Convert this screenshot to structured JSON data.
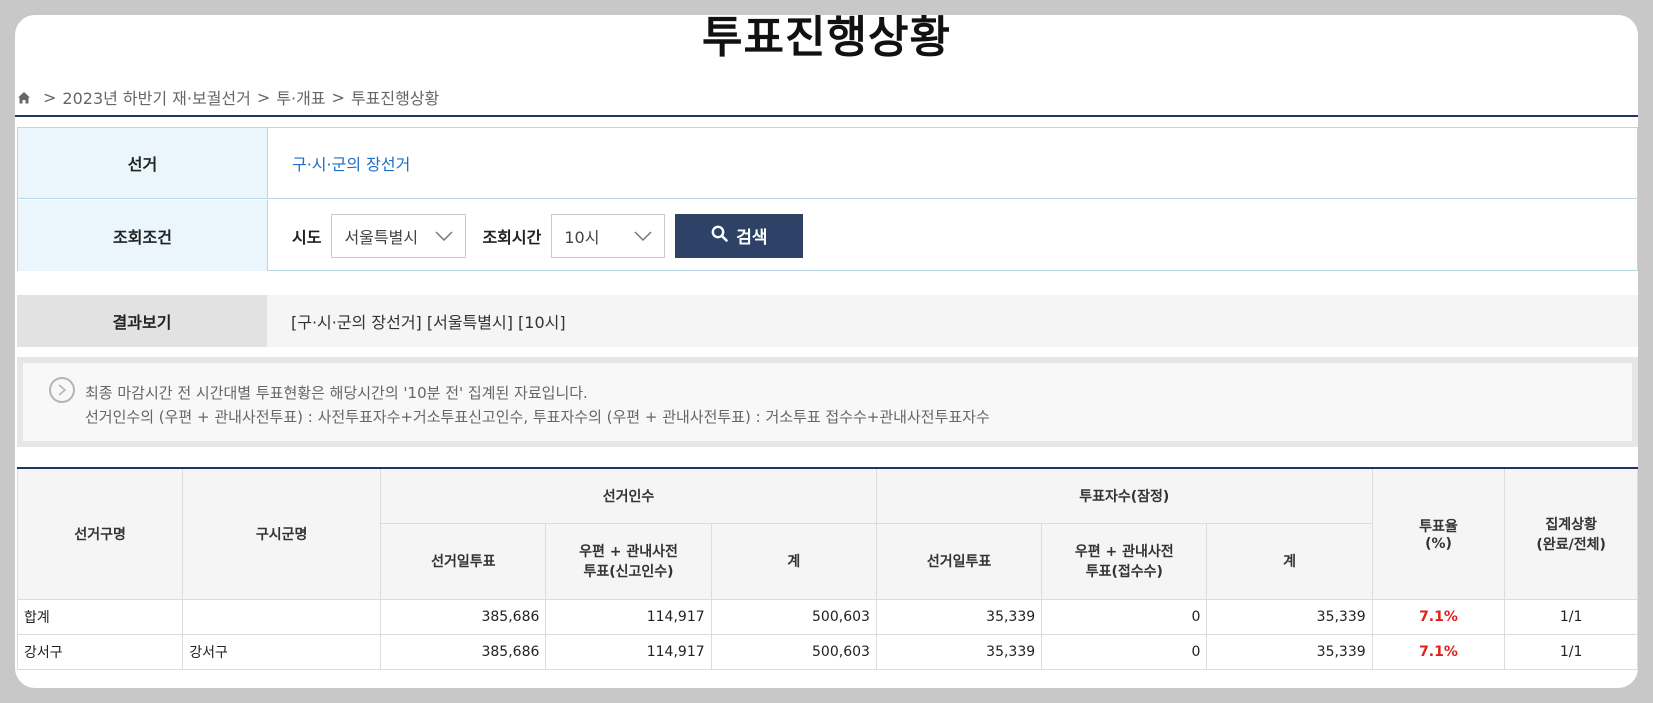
{
  "title": "투표진행상황",
  "breadcrumb": [
    "2023년 하반기 재·보궐선거",
    "투·개표",
    "투표진행상황"
  ],
  "conditions": {
    "election_label": "선거",
    "election_value": "구·시·군의 장선거",
    "query_label": "조회조건",
    "sido_label": "시도",
    "sido_value": "서울특별시",
    "time_label": "조회시간",
    "time_value": "10시",
    "search_label": "검색"
  },
  "result": {
    "label": "결과보기",
    "value": "[구·시·군의 장선거] [서울특별시] [10시]"
  },
  "notice": {
    "line1": "최종 마감시간 전 시간대별 투표현황은 해당시간의 '10분 전' 집계된 자료입니다.",
    "line2": "선거인수의 (우편 + 관내사전투표) : 사전투표자수+거소투표신고인수, 투표자수의 (우편 + 관내사전투표) : 거소투표 접수수+관내사전투표자수"
  },
  "table": {
    "headers": {
      "district": "선거구명",
      "gusigun": "구시군명",
      "electors": "선거인수",
      "voters": "투표자수(잠정)",
      "eday": "선거일투표",
      "mail_elect": "우편 + 관내사전\n투표(신고인수)",
      "total": "계",
      "mail_vote": "우편 + 관내사전\n투표(접수수)",
      "rate": "투표율\n(%)",
      "status": "집계상황\n(완료/전체)"
    },
    "rows": [
      {
        "district": "합계",
        "gusigun": "",
        "e_day": "385,686",
        "e_mail": "114,917",
        "e_total": "500,603",
        "v_day": "35,339",
        "v_mail": "0",
        "v_total": "35,339",
        "rate": "7.1%",
        "status": "1/1"
      },
      {
        "district": "강서구",
        "gusigun": "강서구",
        "e_day": "385,686",
        "e_mail": "114,917",
        "e_total": "500,603",
        "v_day": "35,339",
        "v_mail": "0",
        "v_total": "35,339",
        "rate": "7.1%",
        "status": "1/1"
      }
    ]
  },
  "colors": {
    "accent_navy": "#2d4266",
    "rule_navy": "#1f3564",
    "link_blue": "#1a6fc9",
    "rate_red": "#e0201b"
  }
}
